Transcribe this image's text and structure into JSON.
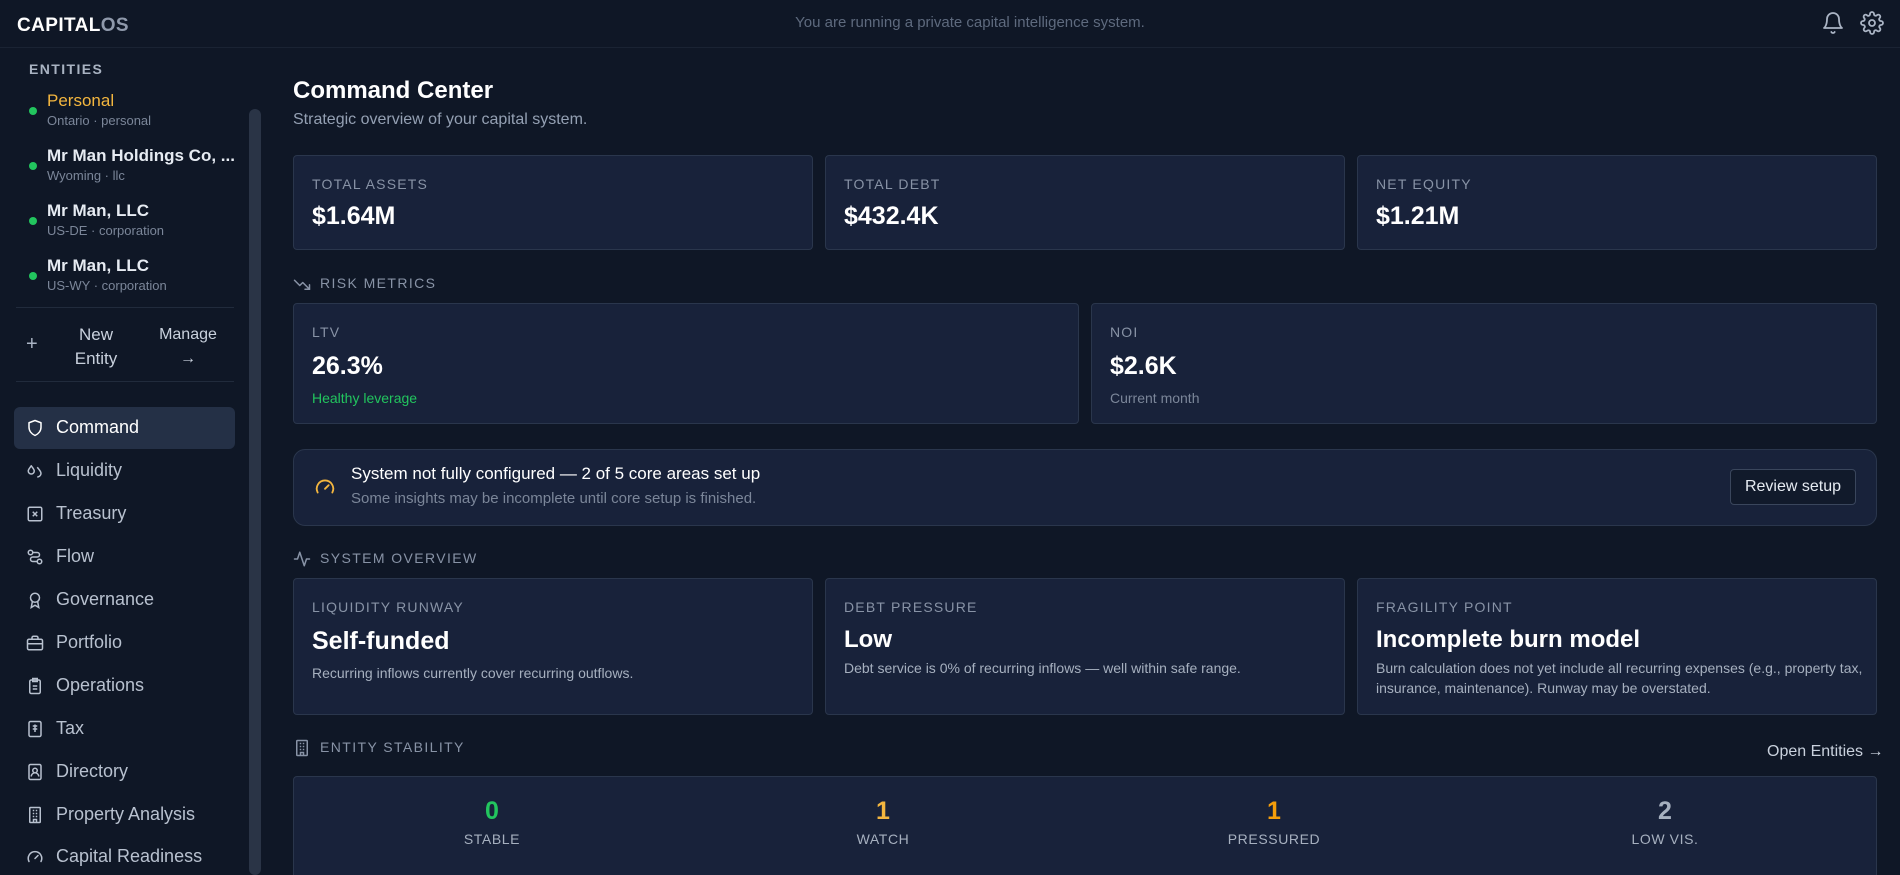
{
  "brand": {
    "main": "CAPITAL",
    "suffix": "OS"
  },
  "topbar": {
    "tagline": "You are running a private capital intelligence system.",
    "icons": [
      "bell-icon",
      "gear-icon"
    ]
  },
  "sidebar": {
    "section_label": "ENTITIES",
    "entities": [
      {
        "name": "Personal",
        "sub": "Ontario · personal",
        "active": true,
        "status_color": "#22c55e"
      },
      {
        "name": "Mr Man Holdings Co, ...",
        "sub": "Wyoming · llc",
        "active": false,
        "status_color": "#22c55e"
      },
      {
        "name": "Mr Man, LLC",
        "sub": "US-DE · corporation",
        "active": false,
        "status_color": "#22c55e"
      },
      {
        "name": "Mr Man, LLC",
        "sub": "US-WY · corporation",
        "active": false,
        "status_color": "#22c55e"
      }
    ],
    "new_entity_line1": "New",
    "new_entity_line2": "Entity",
    "manage_label": "Manage",
    "manage_arrow": "→",
    "nav": [
      {
        "label": "Command",
        "icon": "shield-icon",
        "active": true
      },
      {
        "label": "Liquidity",
        "icon": "droplets-icon",
        "active": false
      },
      {
        "label": "Treasury",
        "icon": "box-x-icon",
        "active": false
      },
      {
        "label": "Flow",
        "icon": "flow-icon",
        "active": false
      },
      {
        "label": "Governance",
        "icon": "award-icon",
        "active": false
      },
      {
        "label": "Portfolio",
        "icon": "briefcase-icon",
        "active": false
      },
      {
        "label": "Operations",
        "icon": "clipboard-icon",
        "active": false
      },
      {
        "label": "Tax",
        "icon": "receipt-icon",
        "active": false
      },
      {
        "label": "Directory",
        "icon": "contact-icon",
        "active": false
      },
      {
        "label": "Property Analysis",
        "icon": "building-icon",
        "active": false
      },
      {
        "label": "Capital Readiness",
        "icon": "gauge-icon",
        "active": false
      }
    ]
  },
  "main": {
    "title": "Command Center",
    "subtitle": "Strategic overview of your capital system.",
    "summary": [
      {
        "label": "TOTAL ASSETS",
        "value": "$1.64M"
      },
      {
        "label": "TOTAL DEBT",
        "value": "$432.4K"
      },
      {
        "label": "NET EQUITY",
        "value": "$1.21M"
      }
    ],
    "risk_heading": "RISK METRICS",
    "risk": [
      {
        "label": "LTV",
        "value": "26.3%",
        "note": "Healthy leverage"
      },
      {
        "label": "NOI",
        "value": "$2.6K",
        "note": "Current month"
      }
    ],
    "alert": {
      "title": "System not fully configured — 2 of 5 core areas set up",
      "subtitle": "Some insights may be incomplete until core setup is finished.",
      "button": "Review setup"
    },
    "overview_heading": "SYSTEM OVERVIEW",
    "overview": [
      {
        "label": "LIQUIDITY RUNWAY",
        "value": "Self-funded",
        "desc": "Recurring inflows currently cover recurring outflows."
      },
      {
        "label": "DEBT PRESSURE",
        "value": "Low",
        "desc": "Debt service is 0% of recurring inflows — well within safe range."
      },
      {
        "label": "FRAGILITY POINT",
        "value": "Incomplete burn model",
        "desc": "Burn calculation does not yet include all recurring expenses (e.g., property tax, insurance, maintenance). Runway may be overstated."
      }
    ],
    "stability_heading": "ENTITY STABILITY",
    "open_entities": "Open Entities →",
    "stability": [
      {
        "count": "0",
        "label": "STABLE",
        "color": "#22c55e"
      },
      {
        "count": "1",
        "label": "WATCH",
        "color": "#f3b63f"
      },
      {
        "count": "1",
        "label": "PRESSURED",
        "color": "#f59e0b"
      },
      {
        "count": "2",
        "label": "LOW VIS.",
        "color": "#a6b0bf"
      }
    ]
  }
}
